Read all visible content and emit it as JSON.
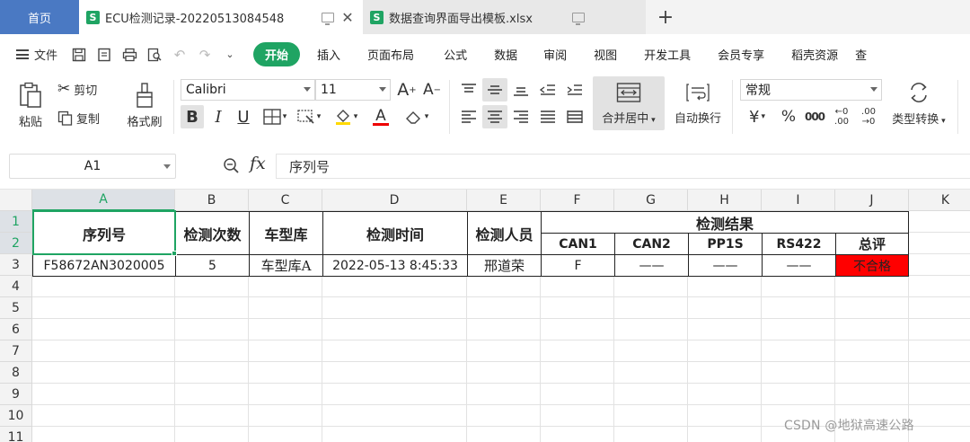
{
  "tabs": {
    "home": "首页",
    "active_doc": "ECU检测记录-20220513084548",
    "other_doc": "数据查询界面导出模板.xlsx",
    "doc_icon_letter": "S"
  },
  "menu": {
    "file": "文件",
    "items": [
      "开始",
      "插入",
      "页面布局",
      "公式",
      "数据",
      "审阅",
      "视图",
      "开发工具",
      "会员专享",
      "稻壳资源"
    ],
    "overflow": "查"
  },
  "ribbon": {
    "paste": "粘贴",
    "cut": "剪切",
    "copy": "复制",
    "format_painter": "格式刷",
    "font_name": "Calibri",
    "font_size": "11",
    "merge_center": "合并居中",
    "wrap_text": "自动换行",
    "number_format": "常规",
    "type_convert": "类型转换",
    "dec_inc": ".00",
    "dec_dec": ".00"
  },
  "formula_bar": {
    "cell_ref": "A1",
    "fx": "fx",
    "content": "序列号"
  },
  "sheet": {
    "columns": [
      "A",
      "B",
      "C",
      "D",
      "E",
      "F",
      "G",
      "H",
      "I",
      "J",
      "K"
    ],
    "rows": [
      "1",
      "2",
      "3",
      "4",
      "5",
      "6",
      "7",
      "8",
      "9",
      "10",
      "11"
    ],
    "headers": {
      "serial": "序列号",
      "count": "检测次数",
      "model": "车型库",
      "time": "检测时间",
      "inspector": "检测人员",
      "result": "检测结果",
      "can1": "CAN1",
      "can2": "CAN2",
      "pp1s": "PP1S",
      "rs422": "RS422",
      "overall": "总评"
    },
    "record": {
      "serial": "F58672AN3020005",
      "count": "5",
      "model": "车型库A",
      "time": "2022-05-13 8:45:33",
      "inspector": "邢道荣",
      "can1": "F",
      "can2": "——",
      "pp1s": "——",
      "rs422": "——",
      "overall": "不合格"
    },
    "fail_color": "#ff0000"
  },
  "watermark": "CSDN @地狱高速公路"
}
